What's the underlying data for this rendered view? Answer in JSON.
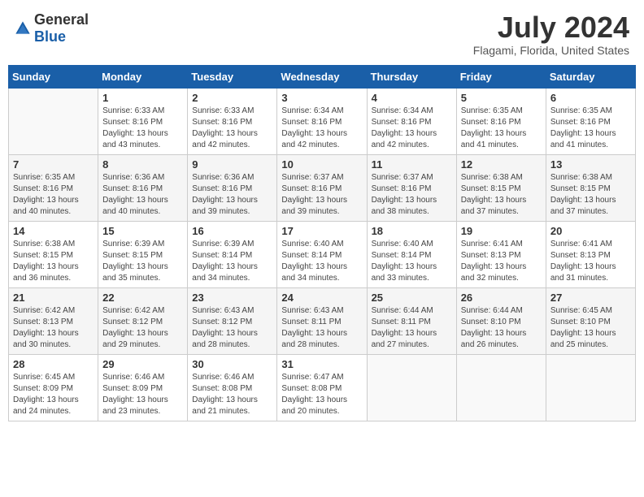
{
  "logo": {
    "general": "General",
    "blue": "Blue"
  },
  "header": {
    "month": "July 2024",
    "location": "Flagami, Florida, United States"
  },
  "days_of_week": [
    "Sunday",
    "Monday",
    "Tuesday",
    "Wednesday",
    "Thursday",
    "Friday",
    "Saturday"
  ],
  "weeks": [
    [
      {
        "day": "",
        "info": ""
      },
      {
        "day": "1",
        "info": "Sunrise: 6:33 AM\nSunset: 8:16 PM\nDaylight: 13 hours\nand 43 minutes."
      },
      {
        "day": "2",
        "info": "Sunrise: 6:33 AM\nSunset: 8:16 PM\nDaylight: 13 hours\nand 42 minutes."
      },
      {
        "day": "3",
        "info": "Sunrise: 6:34 AM\nSunset: 8:16 PM\nDaylight: 13 hours\nand 42 minutes."
      },
      {
        "day": "4",
        "info": "Sunrise: 6:34 AM\nSunset: 8:16 PM\nDaylight: 13 hours\nand 42 minutes."
      },
      {
        "day": "5",
        "info": "Sunrise: 6:35 AM\nSunset: 8:16 PM\nDaylight: 13 hours\nand 41 minutes."
      },
      {
        "day": "6",
        "info": "Sunrise: 6:35 AM\nSunset: 8:16 PM\nDaylight: 13 hours\nand 41 minutes."
      }
    ],
    [
      {
        "day": "7",
        "info": ""
      },
      {
        "day": "8",
        "info": "Sunrise: 6:36 AM\nSunset: 8:16 PM\nDaylight: 13 hours\nand 40 minutes."
      },
      {
        "day": "9",
        "info": "Sunrise: 6:36 AM\nSunset: 8:16 PM\nDaylight: 13 hours\nand 39 minutes."
      },
      {
        "day": "10",
        "info": "Sunrise: 6:37 AM\nSunset: 8:16 PM\nDaylight: 13 hours\nand 39 minutes."
      },
      {
        "day": "11",
        "info": "Sunrise: 6:37 AM\nSunset: 8:16 PM\nDaylight: 13 hours\nand 38 minutes."
      },
      {
        "day": "12",
        "info": "Sunrise: 6:38 AM\nSunset: 8:15 PM\nDaylight: 13 hours\nand 37 minutes."
      },
      {
        "day": "13",
        "info": "Sunrise: 6:38 AM\nSunset: 8:15 PM\nDaylight: 13 hours\nand 37 minutes."
      }
    ],
    [
      {
        "day": "14",
        "info": ""
      },
      {
        "day": "15",
        "info": "Sunrise: 6:39 AM\nSunset: 8:15 PM\nDaylight: 13 hours\nand 35 minutes."
      },
      {
        "day": "16",
        "info": "Sunrise: 6:39 AM\nSunset: 8:14 PM\nDaylight: 13 hours\nand 34 minutes."
      },
      {
        "day": "17",
        "info": "Sunrise: 6:40 AM\nSunset: 8:14 PM\nDaylight: 13 hours\nand 34 minutes."
      },
      {
        "day": "18",
        "info": "Sunrise: 6:40 AM\nSunset: 8:14 PM\nDaylight: 13 hours\nand 33 minutes."
      },
      {
        "day": "19",
        "info": "Sunrise: 6:41 AM\nSunset: 8:13 PM\nDaylight: 13 hours\nand 32 minutes."
      },
      {
        "day": "20",
        "info": "Sunrise: 6:41 AM\nSunset: 8:13 PM\nDaylight: 13 hours\nand 31 minutes."
      }
    ],
    [
      {
        "day": "21",
        "info": ""
      },
      {
        "day": "22",
        "info": "Sunrise: 6:42 AM\nSunset: 8:12 PM\nDaylight: 13 hours\nand 29 minutes."
      },
      {
        "day": "23",
        "info": "Sunrise: 6:43 AM\nSunset: 8:12 PM\nDaylight: 13 hours\nand 28 minutes."
      },
      {
        "day": "24",
        "info": "Sunrise: 6:43 AM\nSunset: 8:11 PM\nDaylight: 13 hours\nand 28 minutes."
      },
      {
        "day": "25",
        "info": "Sunrise: 6:44 AM\nSunset: 8:11 PM\nDaylight: 13 hours\nand 27 minutes."
      },
      {
        "day": "26",
        "info": "Sunrise: 6:44 AM\nSunset: 8:10 PM\nDaylight: 13 hours\nand 26 minutes."
      },
      {
        "day": "27",
        "info": "Sunrise: 6:45 AM\nSunset: 8:10 PM\nDaylight: 13 hours\nand 25 minutes."
      }
    ],
    [
      {
        "day": "28",
        "info": "Sunrise: 6:45 AM\nSunset: 8:09 PM\nDaylight: 13 hours\nand 24 minutes."
      },
      {
        "day": "29",
        "info": "Sunrise: 6:46 AM\nSunset: 8:09 PM\nDaylight: 13 hours\nand 23 minutes."
      },
      {
        "day": "30",
        "info": "Sunrise: 6:46 AM\nSunset: 8:08 PM\nDaylight: 13 hours\nand 21 minutes."
      },
      {
        "day": "31",
        "info": "Sunrise: 6:47 AM\nSunset: 8:08 PM\nDaylight: 13 hours\nand 20 minutes."
      },
      {
        "day": "",
        "info": ""
      },
      {
        "day": "",
        "info": ""
      },
      {
        "day": "",
        "info": ""
      }
    ]
  ],
  "week1_day7_info": "Sunrise: 6:35 AM\nSunset: 8:16 PM\nDaylight: 13 hours\nand 40 minutes.",
  "week2_day14_info": "Sunrise: 6:38 AM\nSunset: 8:15 PM\nDaylight: 13 hours\nand 36 minutes.",
  "week3_day21_info": "Sunrise: 6:42 AM\nSunset: 8:13 PM\nDaylight: 13 hours\nand 30 minutes."
}
